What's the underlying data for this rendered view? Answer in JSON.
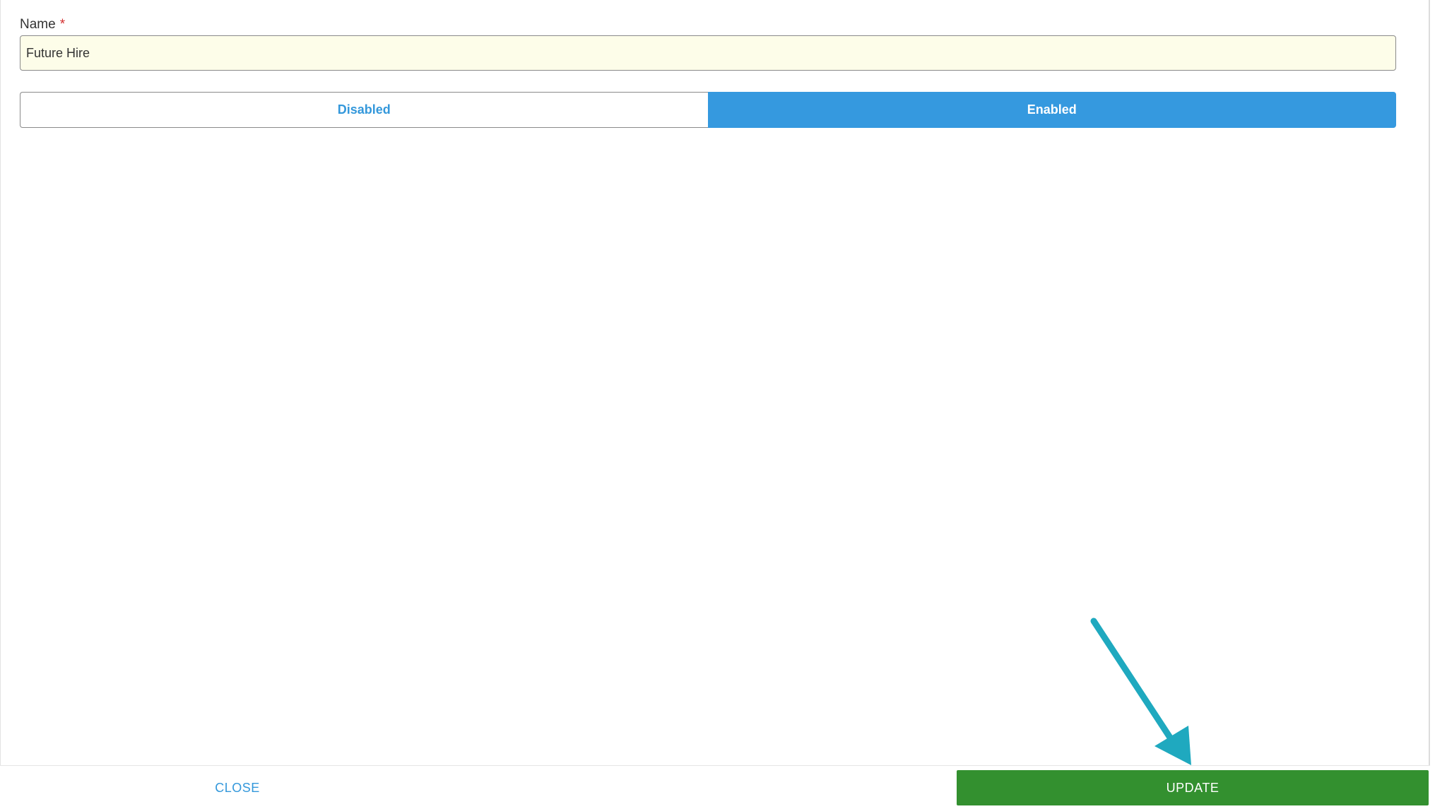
{
  "form": {
    "name_label": "Name",
    "required_marker": "*",
    "name_value": "Future Hire"
  },
  "status_toggle": {
    "disabled_label": "Disabled",
    "enabled_label": "Enabled",
    "selected": "Enabled"
  },
  "footer": {
    "close_label": "CLOSE",
    "update_label": "UPDATE"
  },
  "colors": {
    "accent_blue": "#3599df",
    "link_blue": "#3498db",
    "update_green": "#33902f",
    "annotation_arrow": "#1fa9bf",
    "input_background": "#fdfde9",
    "required_red": "#d32f2f"
  },
  "annotation": {
    "icon": "arrow-annotation-icon"
  }
}
